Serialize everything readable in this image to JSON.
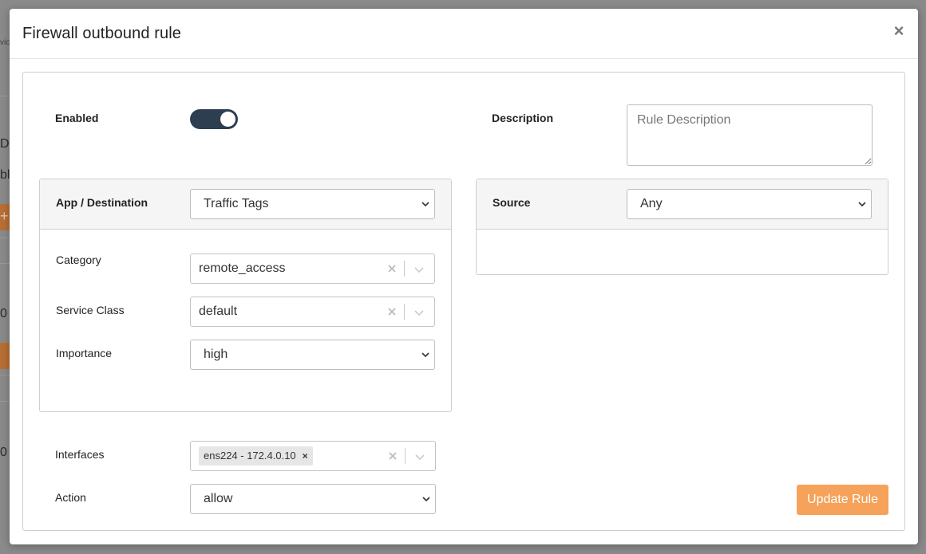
{
  "background": {
    "fragments": [
      "D",
      "bl",
      "+",
      "0",
      "0"
    ],
    "small_text": "vic"
  },
  "modal": {
    "title": "Firewall outbound rule",
    "close_glyph": "×"
  },
  "form": {
    "enabled_label": "Enabled",
    "enabled_value": true,
    "description_label": "Description",
    "description_placeholder": "Rule Description",
    "app_destination": {
      "label": "App / Destination",
      "selected": "Traffic Tags",
      "category": {
        "label": "Category",
        "value": "remote_access"
      },
      "service_class": {
        "label": "Service Class",
        "value": "default"
      },
      "importance": {
        "label": "Importance",
        "value": "high"
      }
    },
    "source": {
      "label": "Source",
      "selected": "Any"
    },
    "interfaces": {
      "label": "Interfaces",
      "chips": [
        "ens224 - 172.4.0.10"
      ],
      "chip_remove_glyph": "×"
    },
    "action": {
      "label": "Action",
      "selected": "allow"
    },
    "update_button_label": "Update Rule"
  },
  "colors": {
    "toggle_on": "#2c3e50",
    "update_button": "#f6a25a",
    "bg_accent": "#b86f35"
  },
  "icons": {
    "close": "close-icon",
    "select": "chevron-down-icon",
    "clear": "clear-x-icon"
  }
}
